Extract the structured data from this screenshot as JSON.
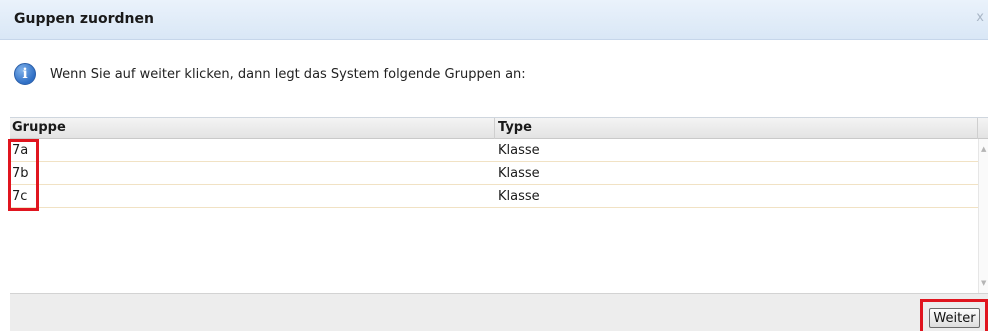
{
  "dialog": {
    "title": "Guppen zuordnen",
    "close_glyph": "x"
  },
  "info": {
    "icon": "info-icon",
    "text": "Wenn Sie auf weiter klicken, dann legt das System folgende Gruppen an:"
  },
  "grid": {
    "columns": [
      "Gruppe",
      "Type"
    ],
    "rows": [
      {
        "gruppe": "7a",
        "type": "Klasse"
      },
      {
        "gruppe": "7b",
        "type": "Klasse"
      },
      {
        "gruppe": "7c",
        "type": "Klasse"
      }
    ]
  },
  "footer": {
    "weiter_label": "Weiter"
  },
  "colors": {
    "title_bar": "#d9e7f6",
    "highlight": "#e0151f",
    "row_border": "#f1e2c4"
  }
}
